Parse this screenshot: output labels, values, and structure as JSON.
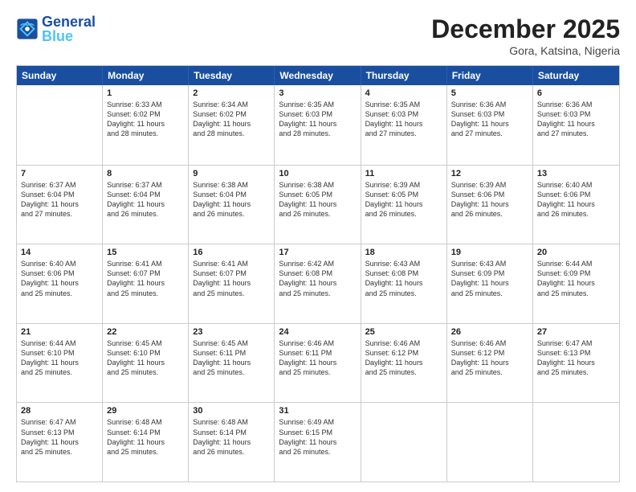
{
  "header": {
    "logo_general": "General",
    "logo_blue": "Blue",
    "month_year": "December 2025",
    "location": "Gora, Katsina, Nigeria"
  },
  "days_of_week": [
    "Sunday",
    "Monday",
    "Tuesday",
    "Wednesday",
    "Thursday",
    "Friday",
    "Saturday"
  ],
  "rows": [
    [
      {
        "num": "",
        "text": ""
      },
      {
        "num": "1",
        "text": "Sunrise: 6:33 AM\nSunset: 6:02 PM\nDaylight: 11 hours\nand 28 minutes."
      },
      {
        "num": "2",
        "text": "Sunrise: 6:34 AM\nSunset: 6:02 PM\nDaylight: 11 hours\nand 28 minutes."
      },
      {
        "num": "3",
        "text": "Sunrise: 6:35 AM\nSunset: 6:03 PM\nDaylight: 11 hours\nand 28 minutes."
      },
      {
        "num": "4",
        "text": "Sunrise: 6:35 AM\nSunset: 6:03 PM\nDaylight: 11 hours\nand 27 minutes."
      },
      {
        "num": "5",
        "text": "Sunrise: 6:36 AM\nSunset: 6:03 PM\nDaylight: 11 hours\nand 27 minutes."
      },
      {
        "num": "6",
        "text": "Sunrise: 6:36 AM\nSunset: 6:03 PM\nDaylight: 11 hours\nand 27 minutes."
      }
    ],
    [
      {
        "num": "7",
        "text": "Sunrise: 6:37 AM\nSunset: 6:04 PM\nDaylight: 11 hours\nand 27 minutes."
      },
      {
        "num": "8",
        "text": "Sunrise: 6:37 AM\nSunset: 6:04 PM\nDaylight: 11 hours\nand 26 minutes."
      },
      {
        "num": "9",
        "text": "Sunrise: 6:38 AM\nSunset: 6:04 PM\nDaylight: 11 hours\nand 26 minutes."
      },
      {
        "num": "10",
        "text": "Sunrise: 6:38 AM\nSunset: 6:05 PM\nDaylight: 11 hours\nand 26 minutes."
      },
      {
        "num": "11",
        "text": "Sunrise: 6:39 AM\nSunset: 6:05 PM\nDaylight: 11 hours\nand 26 minutes."
      },
      {
        "num": "12",
        "text": "Sunrise: 6:39 AM\nSunset: 6:06 PM\nDaylight: 11 hours\nand 26 minutes."
      },
      {
        "num": "13",
        "text": "Sunrise: 6:40 AM\nSunset: 6:06 PM\nDaylight: 11 hours\nand 26 minutes."
      }
    ],
    [
      {
        "num": "14",
        "text": "Sunrise: 6:40 AM\nSunset: 6:06 PM\nDaylight: 11 hours\nand 25 minutes."
      },
      {
        "num": "15",
        "text": "Sunrise: 6:41 AM\nSunset: 6:07 PM\nDaylight: 11 hours\nand 25 minutes."
      },
      {
        "num": "16",
        "text": "Sunrise: 6:41 AM\nSunset: 6:07 PM\nDaylight: 11 hours\nand 25 minutes."
      },
      {
        "num": "17",
        "text": "Sunrise: 6:42 AM\nSunset: 6:08 PM\nDaylight: 11 hours\nand 25 minutes."
      },
      {
        "num": "18",
        "text": "Sunrise: 6:43 AM\nSunset: 6:08 PM\nDaylight: 11 hours\nand 25 minutes."
      },
      {
        "num": "19",
        "text": "Sunrise: 6:43 AM\nSunset: 6:09 PM\nDaylight: 11 hours\nand 25 minutes."
      },
      {
        "num": "20",
        "text": "Sunrise: 6:44 AM\nSunset: 6:09 PM\nDaylight: 11 hours\nand 25 minutes."
      }
    ],
    [
      {
        "num": "21",
        "text": "Sunrise: 6:44 AM\nSunset: 6:10 PM\nDaylight: 11 hours\nand 25 minutes."
      },
      {
        "num": "22",
        "text": "Sunrise: 6:45 AM\nSunset: 6:10 PM\nDaylight: 11 hours\nand 25 minutes."
      },
      {
        "num": "23",
        "text": "Sunrise: 6:45 AM\nSunset: 6:11 PM\nDaylight: 11 hours\nand 25 minutes."
      },
      {
        "num": "24",
        "text": "Sunrise: 6:46 AM\nSunset: 6:11 PM\nDaylight: 11 hours\nand 25 minutes."
      },
      {
        "num": "25",
        "text": "Sunrise: 6:46 AM\nSunset: 6:12 PM\nDaylight: 11 hours\nand 25 minutes."
      },
      {
        "num": "26",
        "text": "Sunrise: 6:46 AM\nSunset: 6:12 PM\nDaylight: 11 hours\nand 25 minutes."
      },
      {
        "num": "27",
        "text": "Sunrise: 6:47 AM\nSunset: 6:13 PM\nDaylight: 11 hours\nand 25 minutes."
      }
    ],
    [
      {
        "num": "28",
        "text": "Sunrise: 6:47 AM\nSunset: 6:13 PM\nDaylight: 11 hours\nand 25 minutes."
      },
      {
        "num": "29",
        "text": "Sunrise: 6:48 AM\nSunset: 6:14 PM\nDaylight: 11 hours\nand 25 minutes."
      },
      {
        "num": "30",
        "text": "Sunrise: 6:48 AM\nSunset: 6:14 PM\nDaylight: 11 hours\nand 26 minutes."
      },
      {
        "num": "31",
        "text": "Sunrise: 6:49 AM\nSunset: 6:15 PM\nDaylight: 11 hours\nand 26 minutes."
      },
      {
        "num": "",
        "text": ""
      },
      {
        "num": "",
        "text": ""
      },
      {
        "num": "",
        "text": ""
      }
    ]
  ]
}
